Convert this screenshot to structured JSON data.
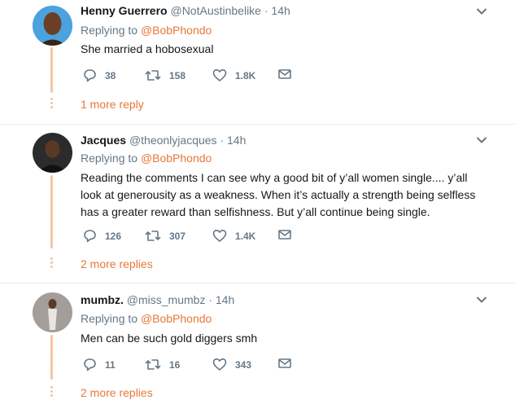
{
  "tweets": [
    {
      "name": "Henny Guerrero",
      "handle": "@NotAustinbelike",
      "time": "· 14h",
      "replying_prefix": "Replying to",
      "replying_to": "@BobPhondo",
      "text": "She married a hobosexual",
      "replies": "38",
      "retweets": "158",
      "likes": "1.8K",
      "more": "1 more reply"
    },
    {
      "name": "Jacques",
      "handle": "@theonlyjacques",
      "time": "· 14h",
      "replying_prefix": "Replying to",
      "replying_to": "@BobPhondo",
      "text": "Reading the comments I can see why a good bit of y’all women single.... y’all look at generousity as a weakness. When it’s actually a strength being selfless has a greater reward than selfishness. But y’all continue being single.",
      "replies": "126",
      "retweets": "307",
      "likes": "1.4K",
      "more": "2 more replies"
    },
    {
      "name": "mumbz.",
      "handle": "@miss_mumbz",
      "time": "· 14h",
      "replying_prefix": "Replying to",
      "replying_to": "@BobPhondo",
      "text": "Men can be such gold diggers smh",
      "replies": "11",
      "retweets": "16",
      "likes": "343",
      "more": "2 more replies"
    }
  ],
  "colors": {
    "accent": "#e8773a",
    "thread": "#f8c6a4",
    "muted": "#657786",
    "separator": "#e6ecf0"
  },
  "icons": {
    "reply": "reply-icon",
    "retweet": "retweet-icon",
    "like": "heart-icon",
    "dm": "envelope-icon",
    "menu": "chevron-down-icon"
  }
}
